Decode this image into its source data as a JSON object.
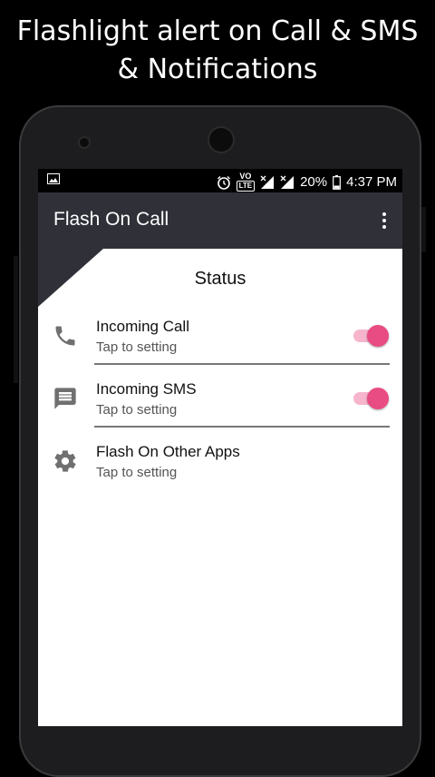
{
  "promo": {
    "line1": "Flashlight alert on Call & SMS",
    "line2": "& Notifications"
  },
  "statusbar": {
    "vo_label": "VO",
    "lte_label": "LTE",
    "battery": "20%",
    "time": "4:37 PM"
  },
  "appbar": {
    "title": "Flash On Call"
  },
  "main": {
    "section_title": "Status",
    "rows": [
      {
        "title": "Incoming Call",
        "subtitle": "Tap to setting",
        "icon": "phone-icon",
        "toggle_on": true
      },
      {
        "title": "Incoming SMS",
        "subtitle": "Tap to setting",
        "icon": "message-icon",
        "toggle_on": true
      },
      {
        "title": "Flash On Other Apps",
        "subtitle": "Tap to setting",
        "icon": "gear-icon"
      }
    ]
  },
  "colors": {
    "appbar": "#2f3038",
    "accent": "#e94b83",
    "track": "#f6b5cc"
  }
}
